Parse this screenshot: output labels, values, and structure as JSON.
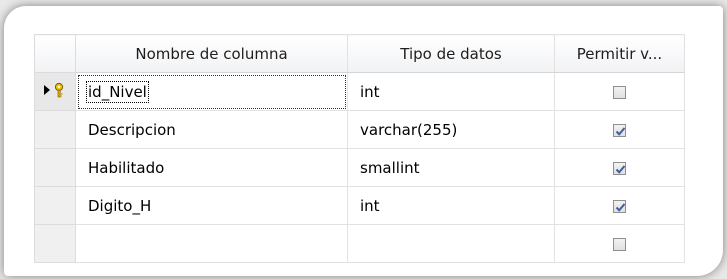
{
  "columns": {
    "name": "Nombre de columna",
    "type": "Tipo de datos",
    "nullable": "Permitir v..."
  },
  "rows": [
    {
      "name": "id_Nivel",
      "type": "int",
      "allow_nulls": false,
      "primary_key": true
    },
    {
      "name": "Descripcion",
      "type": "varchar(255)",
      "allow_nulls": true,
      "primary_key": false
    },
    {
      "name": "Habilitado",
      "type": "smallint",
      "allow_nulls": true,
      "primary_key": false
    },
    {
      "name": "Digito_H",
      "type": "int",
      "allow_nulls": true,
      "primary_key": false
    },
    {
      "name": "",
      "type": "",
      "allow_nulls": false,
      "primary_key": false
    }
  ],
  "icons": {
    "row_marker": "primary-key-selected-row-icon"
  },
  "colors": {
    "check": "#3d5f9e",
    "grid_line": "#e2e2e2"
  }
}
